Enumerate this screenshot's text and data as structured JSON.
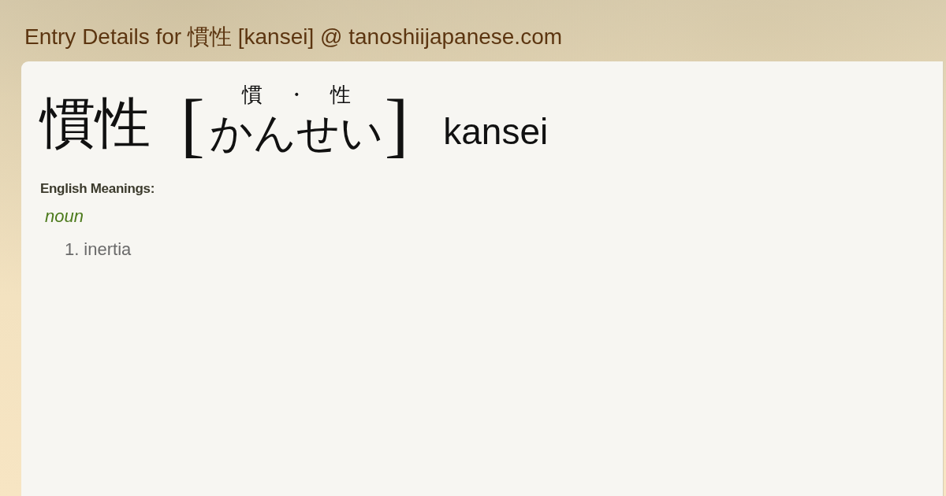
{
  "title": "Entry Details for 慣性 [kansei] @ tanoshiijapanese.com",
  "entry": {
    "headword": "慣性",
    "bracket_open": "[",
    "furigana": [
      "慣",
      "・",
      "性"
    ],
    "reading": "かんせい",
    "bracket_close": "]",
    "romaji": "kansei"
  },
  "meanings": {
    "label": "English Meanings:",
    "groups": [
      {
        "part_of_speech": "noun",
        "senses": [
          {
            "number": "1.",
            "text": "inertia"
          }
        ]
      }
    ]
  }
}
